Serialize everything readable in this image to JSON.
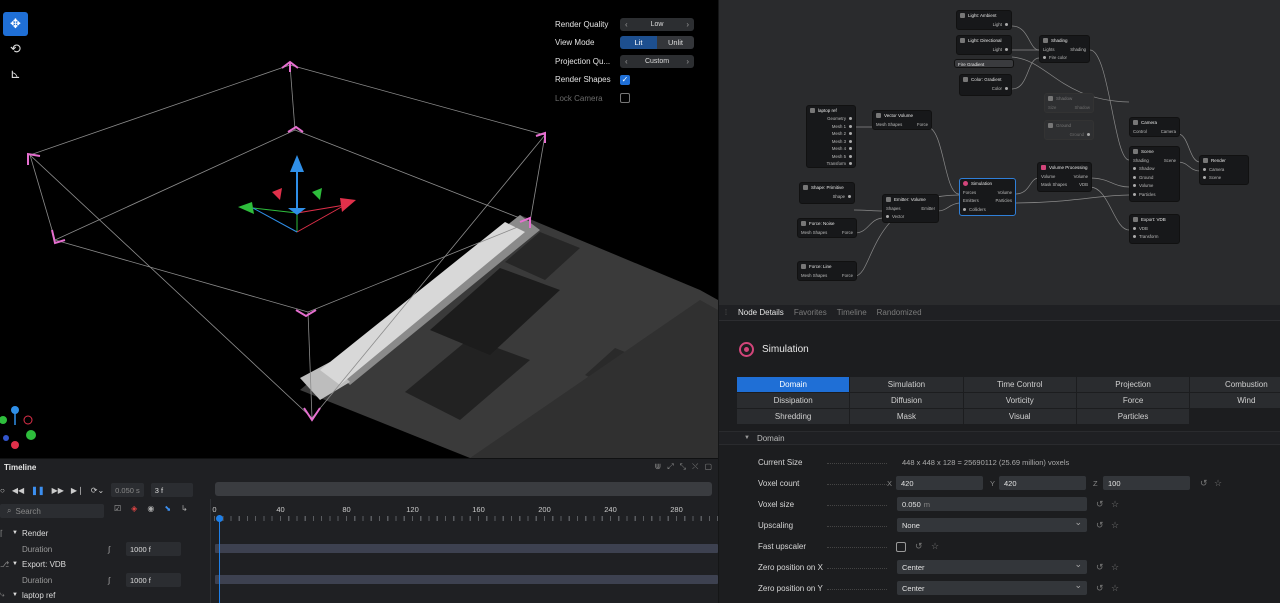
{
  "viewport": {
    "tools": [
      "move-icon",
      "orbit-icon",
      "axes-icon"
    ],
    "overlay": {
      "render_quality": {
        "label": "Render Quality",
        "value": "Low"
      },
      "view_mode": {
        "label": "View Mode",
        "options": [
          "Lit",
          "Unlit"
        ],
        "selected": "Lit"
      },
      "projection": {
        "label": "Projection Qu...",
        "value": "Custom"
      },
      "render_shapes": {
        "label": "Render Shapes",
        "checked": true
      },
      "lock_camera": {
        "label": "Lock Camera",
        "checked": false
      }
    },
    "colors": {
      "bbox": "#e66fd0",
      "axis_x": "#e0304a",
      "axis_y": "#2ebd3c",
      "axis_z": "#2f8fe8"
    }
  },
  "timeline": {
    "title": "Timeline",
    "time_value": "0.050 s",
    "frame_value": "3 f",
    "search_placeholder": "Search",
    "ruler": [
      "0",
      "40",
      "80",
      "120",
      "160",
      "200",
      "240",
      "280"
    ],
    "tracks": [
      {
        "name": "Render",
        "type": "group"
      },
      {
        "name": "Duration",
        "type": "sub",
        "value": "1000 f"
      },
      {
        "name": "Export: VDB",
        "type": "group"
      },
      {
        "name": "Duration",
        "type": "sub",
        "value": "1000 f"
      },
      {
        "name": "laptop ref",
        "type": "group"
      }
    ]
  },
  "graph": {
    "nodes": {
      "light_ambient": {
        "title": "Light: Ambient",
        "ports": [
          "Light"
        ]
      },
      "light_directional": {
        "title": "Light: Directional",
        "ports": [
          "Light"
        ]
      },
      "fire_gradient": {
        "title": "Fire Gradient"
      },
      "color_gradient": {
        "title": "Color: Gradient",
        "ports": [
          "Color"
        ]
      },
      "shading": {
        "title": "Shading",
        "ports": [
          "Lights",
          "Shading",
          "Fire color"
        ]
      },
      "shadow": {
        "title": "Shadow",
        "ports": [
          "Size",
          "Shadow"
        ]
      },
      "ground": {
        "title": "Ground",
        "ports": [
          "Ground"
        ]
      },
      "laptop_ref": {
        "title": "laptop ref",
        "ports": [
          "Geometry",
          "Mesh 1",
          "Mesh 2",
          "Mesh 3",
          "Mesh 4",
          "Mesh 5",
          "Transform"
        ]
      },
      "vector_volume": {
        "title": "Vector Volume",
        "ports": [
          "Mesh Shapes",
          "Force"
        ]
      },
      "shape_primitive": {
        "title": "Shape: Primitive",
        "ports": [
          "Shape"
        ]
      },
      "emitter_volume": {
        "title": "Emitter: Volume",
        "ports": [
          "Shapes",
          "Emitter",
          "Vector"
        ]
      },
      "force_noise": {
        "title": "Force: Noise",
        "ports": [
          "Mesh Shapes",
          "Force"
        ]
      },
      "force_line": {
        "title": "Force: Line",
        "ports": [
          "Mesh Shapes",
          "Force"
        ]
      },
      "simulation": {
        "title": "Simulation",
        "ports": [
          "Forces",
          "Volume",
          "Emitters",
          "Particles",
          "Colliders"
        ]
      },
      "volume_processing": {
        "title": "Volume Processing",
        "ports": [
          "Volume",
          "Volume",
          "Mask Shapes",
          "VDB"
        ]
      },
      "camera": {
        "title": "Camera",
        "ports": [
          "Control",
          "Camera"
        ]
      },
      "scene": {
        "title": "Scene",
        "ports": [
          "Shading",
          "Scene",
          "Shadow",
          "Ground",
          "Volume",
          "Particles"
        ]
      },
      "render": {
        "title": "Render",
        "ports": [
          "Camera",
          "Scene"
        ]
      },
      "export_vdb": {
        "title": "Export: VDB",
        "ports": [
          "VDB",
          "Transform"
        ]
      }
    }
  },
  "details": {
    "tabs": [
      "Node Details",
      "Favorites",
      "Timeline",
      "Randomized"
    ],
    "active_tab": "Node Details",
    "node_title": "Simulation",
    "categories": [
      "Domain",
      "Simulation",
      "Time Control",
      "Projection",
      "Combustion",
      "Dissipation",
      "Diffusion",
      "Vorticity",
      "Force",
      "Wind",
      "Shredding",
      "Mask",
      "Visual",
      "Particles"
    ],
    "active_category": "Domain",
    "section": "Domain",
    "current_size": {
      "label": "Current Size",
      "value": "448 x 448 x 128 = 25690112 (25.69 million) voxels"
    },
    "voxel_count": {
      "label": "Voxel count",
      "x_label": "X",
      "x": "420",
      "y_label": "Y",
      "y": "420",
      "z_label": "Z",
      "z": "100"
    },
    "voxel_size": {
      "label": "Voxel size",
      "value": "0.050",
      "unit": "m"
    },
    "upscaling": {
      "label": "Upscaling",
      "value": "None"
    },
    "fast_upscaler": {
      "label": "Fast upscaler",
      "checked": false
    },
    "zero_x": {
      "label": "Zero position on X",
      "value": "Center"
    },
    "zero_y": {
      "label": "Zero position on Y",
      "value": "Center"
    }
  }
}
